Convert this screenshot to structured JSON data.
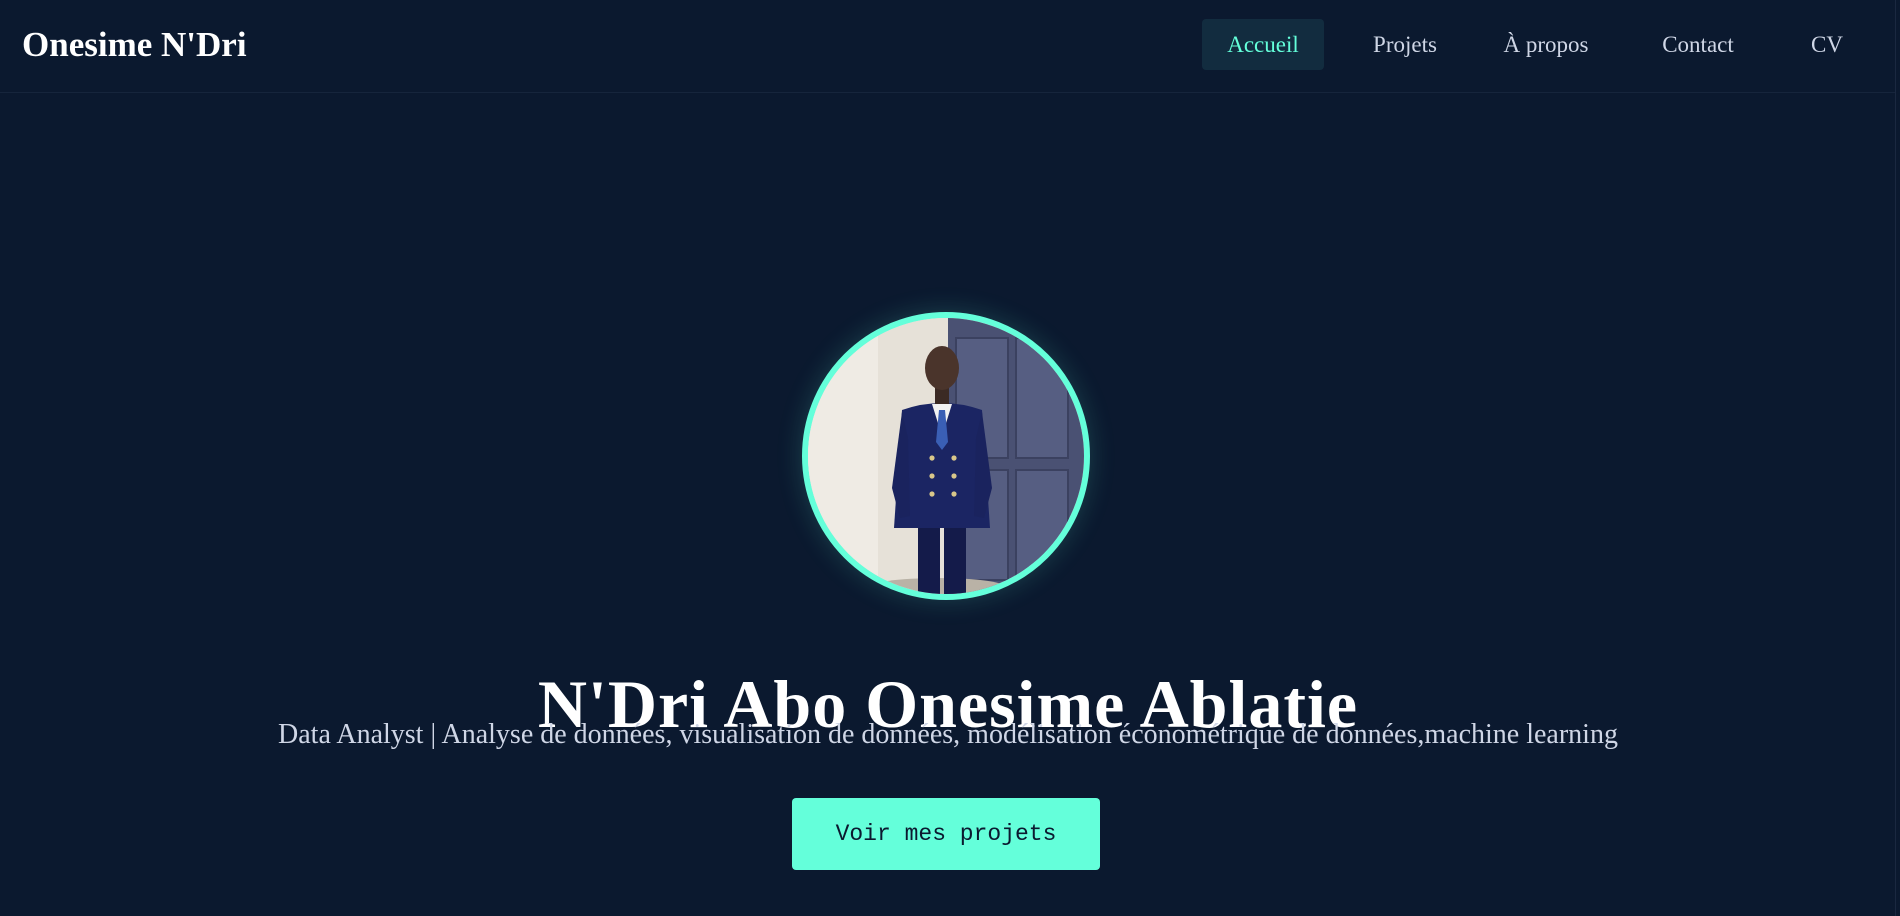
{
  "header": {
    "brand": "Onesime N'Dri",
    "nav": [
      {
        "label": "Accueil",
        "active": true
      },
      {
        "label": "Projets",
        "active": false
      },
      {
        "label": "À propos",
        "active": false
      },
      {
        "label": "Contact",
        "active": false
      },
      {
        "label": "CV",
        "active": false
      }
    ]
  },
  "hero": {
    "photo": "profile-photo",
    "title": "N'Dri Abo Onesime Ablatie",
    "subtitle": "Data Analyst | Analyse de données, visualisation de données, modélisation économétrique de données,machine learning",
    "cta_label": "Voir mes projets"
  },
  "colors": {
    "background": "#0b192f",
    "accent": "#64ffda",
    "text": "#ffffff",
    "muted_text": "#cfd6e6",
    "active_nav_bg": "#122c3f"
  }
}
